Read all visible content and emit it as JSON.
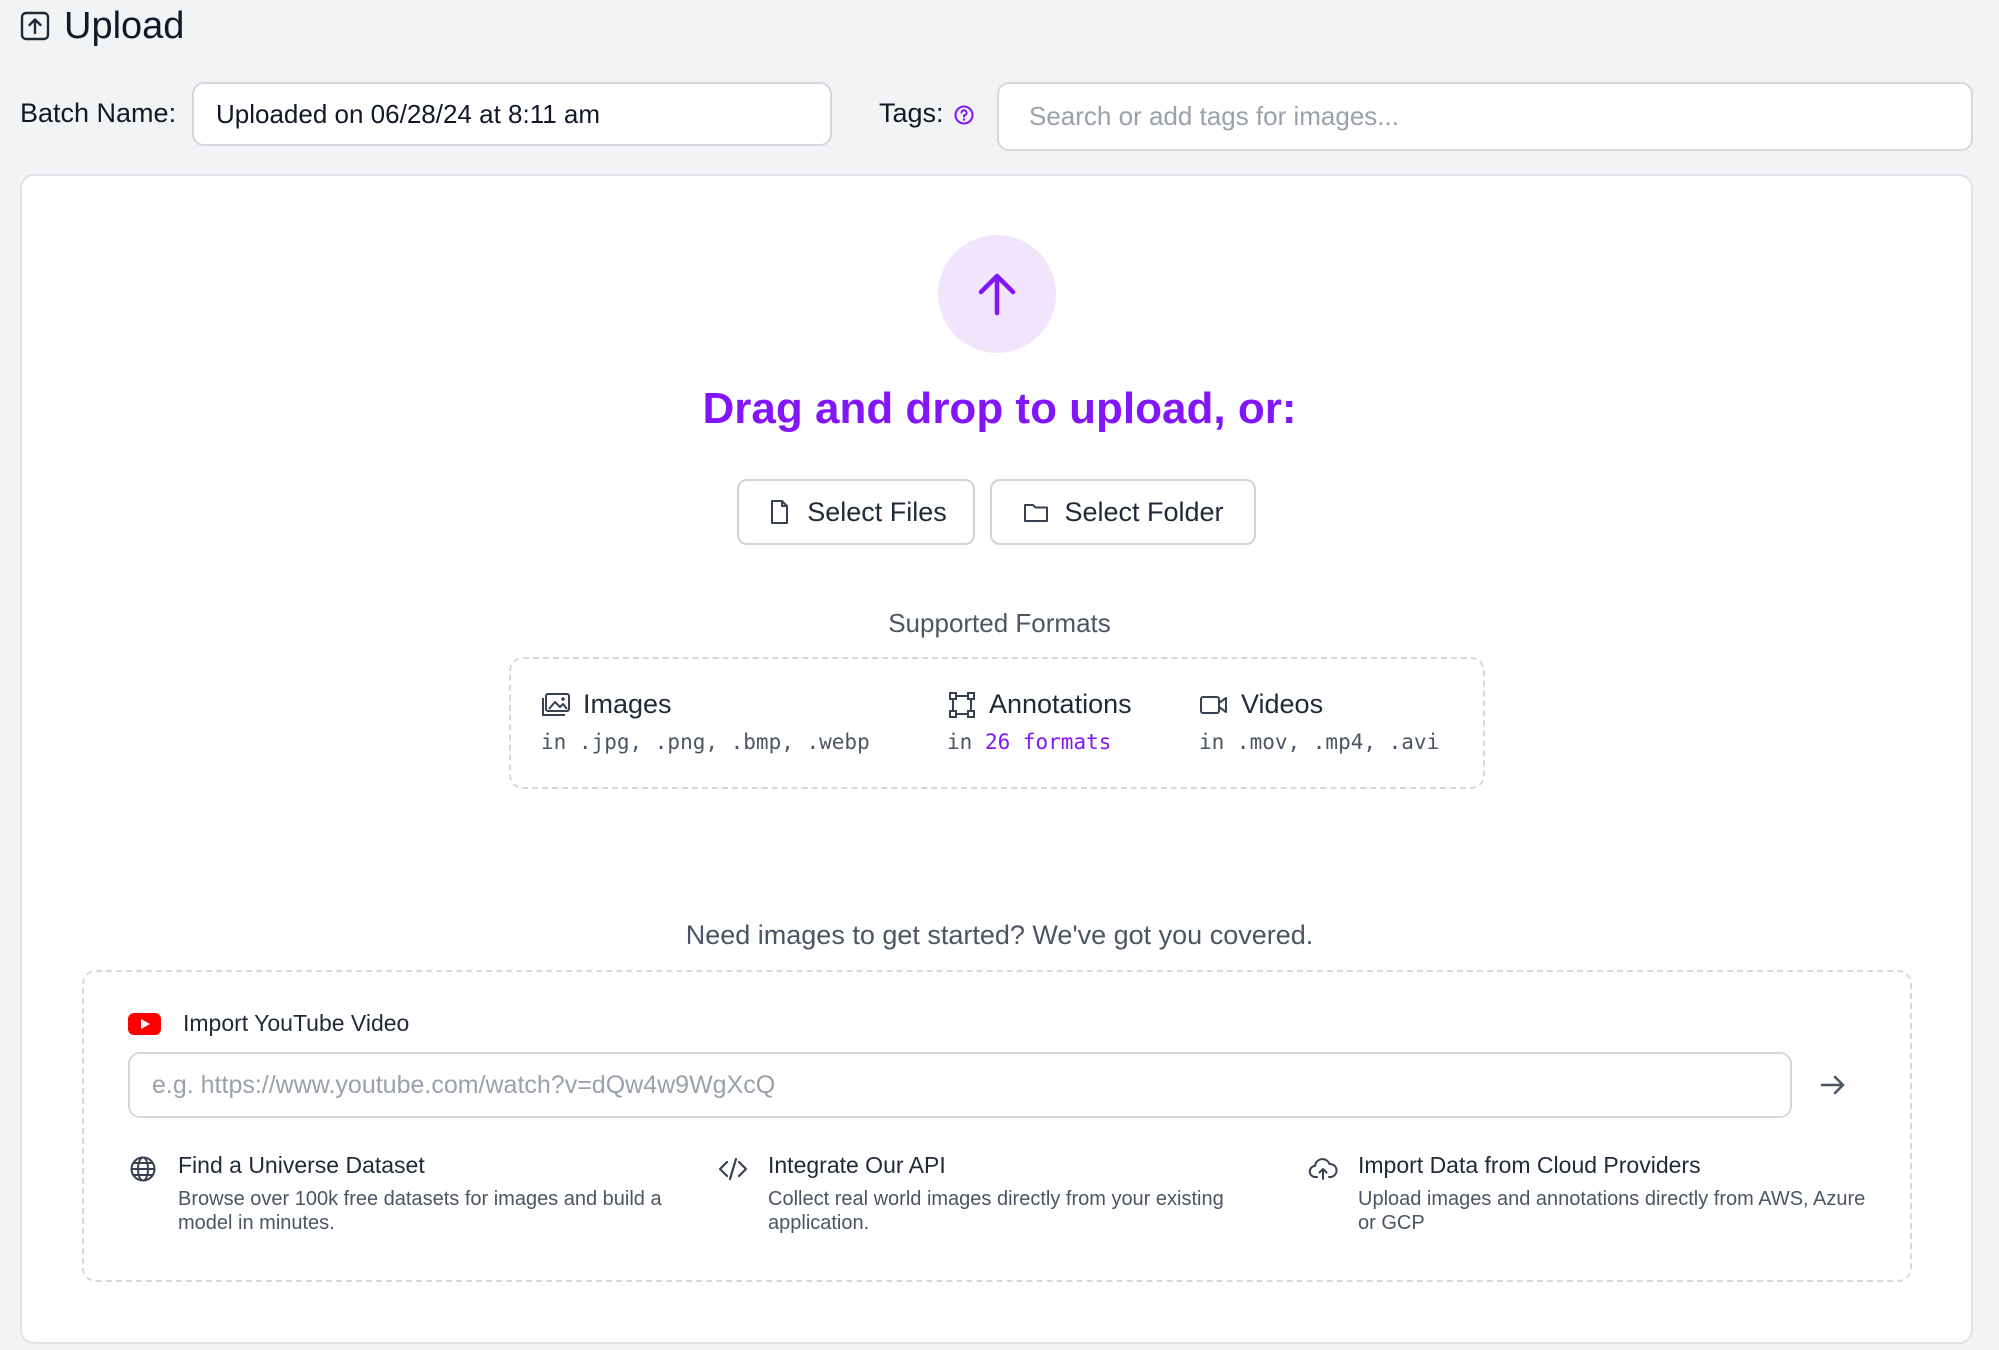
{
  "header": {
    "title": "Upload"
  },
  "batch": {
    "label": "Batch Name:",
    "value": "Uploaded on 06/28/24 at 8:11 am"
  },
  "tags": {
    "label": "Tags:",
    "placeholder": "Search or add tags for images..."
  },
  "dropzone": {
    "headline": "Drag and drop to upload, or:",
    "select_files": "Select Files",
    "select_folder": "Select Folder",
    "accent_color": "#8315f9"
  },
  "formats": {
    "title": "Supported Formats",
    "images": {
      "label": "Images",
      "desc": "in .jpg, .png, .bmp, .webp"
    },
    "annotations": {
      "label": "Annotations",
      "desc_prefix": "in ",
      "desc_link": "26 formats"
    },
    "videos": {
      "label": "Videos",
      "desc": "in .mov, .mp4, .avi"
    }
  },
  "starter": {
    "headline": "Need images to get started? We've got you covered.",
    "youtube": {
      "label": "Import YouTube Video",
      "placeholder": "e.g. https://www.youtube.com/watch?v=dQw4w9WgXcQ"
    },
    "options": [
      {
        "title": "Find a Universe Dataset",
        "desc": "Browse over 100k free datasets for images and build a model in minutes."
      },
      {
        "title": "Integrate Our API",
        "desc": "Collect real world images directly from your existing application."
      },
      {
        "title": "Import Data from Cloud Providers",
        "desc": "Upload images and annotations directly from AWS, Azure or GCP"
      }
    ]
  }
}
